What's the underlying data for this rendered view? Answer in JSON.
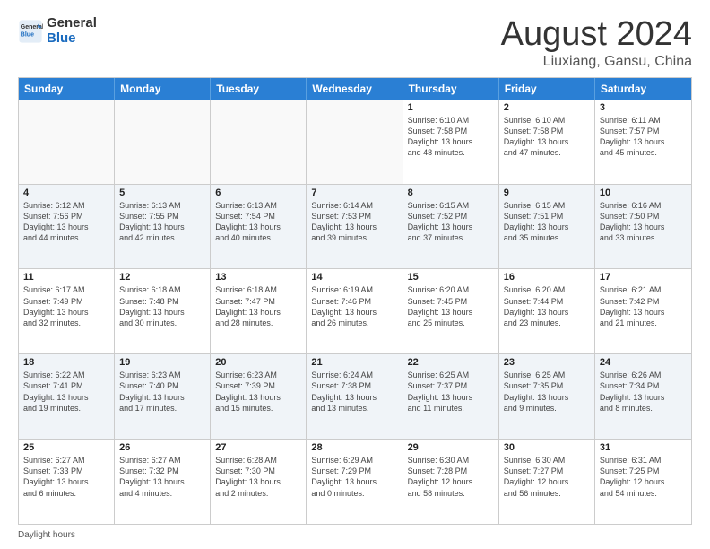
{
  "logo": {
    "text_general": "General",
    "text_blue": "Blue"
  },
  "title": "August 2024",
  "subtitle": "Liuxiang, Gansu, China",
  "days_of_week": [
    "Sunday",
    "Monday",
    "Tuesday",
    "Wednesday",
    "Thursday",
    "Friday",
    "Saturday"
  ],
  "footer_label": "Daylight hours",
  "weeks": [
    [
      {
        "day": "",
        "info": ""
      },
      {
        "day": "",
        "info": ""
      },
      {
        "day": "",
        "info": ""
      },
      {
        "day": "",
        "info": ""
      },
      {
        "day": "1",
        "info": "Sunrise: 6:10 AM\nSunset: 7:58 PM\nDaylight: 13 hours\nand 48 minutes."
      },
      {
        "day": "2",
        "info": "Sunrise: 6:10 AM\nSunset: 7:58 PM\nDaylight: 13 hours\nand 47 minutes."
      },
      {
        "day": "3",
        "info": "Sunrise: 6:11 AM\nSunset: 7:57 PM\nDaylight: 13 hours\nand 45 minutes."
      }
    ],
    [
      {
        "day": "4",
        "info": "Sunrise: 6:12 AM\nSunset: 7:56 PM\nDaylight: 13 hours\nand 44 minutes."
      },
      {
        "day": "5",
        "info": "Sunrise: 6:13 AM\nSunset: 7:55 PM\nDaylight: 13 hours\nand 42 minutes."
      },
      {
        "day": "6",
        "info": "Sunrise: 6:13 AM\nSunset: 7:54 PM\nDaylight: 13 hours\nand 40 minutes."
      },
      {
        "day": "7",
        "info": "Sunrise: 6:14 AM\nSunset: 7:53 PM\nDaylight: 13 hours\nand 39 minutes."
      },
      {
        "day": "8",
        "info": "Sunrise: 6:15 AM\nSunset: 7:52 PM\nDaylight: 13 hours\nand 37 minutes."
      },
      {
        "day": "9",
        "info": "Sunrise: 6:15 AM\nSunset: 7:51 PM\nDaylight: 13 hours\nand 35 minutes."
      },
      {
        "day": "10",
        "info": "Sunrise: 6:16 AM\nSunset: 7:50 PM\nDaylight: 13 hours\nand 33 minutes."
      }
    ],
    [
      {
        "day": "11",
        "info": "Sunrise: 6:17 AM\nSunset: 7:49 PM\nDaylight: 13 hours\nand 32 minutes."
      },
      {
        "day": "12",
        "info": "Sunrise: 6:18 AM\nSunset: 7:48 PM\nDaylight: 13 hours\nand 30 minutes."
      },
      {
        "day": "13",
        "info": "Sunrise: 6:18 AM\nSunset: 7:47 PM\nDaylight: 13 hours\nand 28 minutes."
      },
      {
        "day": "14",
        "info": "Sunrise: 6:19 AM\nSunset: 7:46 PM\nDaylight: 13 hours\nand 26 minutes."
      },
      {
        "day": "15",
        "info": "Sunrise: 6:20 AM\nSunset: 7:45 PM\nDaylight: 13 hours\nand 25 minutes."
      },
      {
        "day": "16",
        "info": "Sunrise: 6:20 AM\nSunset: 7:44 PM\nDaylight: 13 hours\nand 23 minutes."
      },
      {
        "day": "17",
        "info": "Sunrise: 6:21 AM\nSunset: 7:42 PM\nDaylight: 13 hours\nand 21 minutes."
      }
    ],
    [
      {
        "day": "18",
        "info": "Sunrise: 6:22 AM\nSunset: 7:41 PM\nDaylight: 13 hours\nand 19 minutes."
      },
      {
        "day": "19",
        "info": "Sunrise: 6:23 AM\nSunset: 7:40 PM\nDaylight: 13 hours\nand 17 minutes."
      },
      {
        "day": "20",
        "info": "Sunrise: 6:23 AM\nSunset: 7:39 PM\nDaylight: 13 hours\nand 15 minutes."
      },
      {
        "day": "21",
        "info": "Sunrise: 6:24 AM\nSunset: 7:38 PM\nDaylight: 13 hours\nand 13 minutes."
      },
      {
        "day": "22",
        "info": "Sunrise: 6:25 AM\nSunset: 7:37 PM\nDaylight: 13 hours\nand 11 minutes."
      },
      {
        "day": "23",
        "info": "Sunrise: 6:25 AM\nSunset: 7:35 PM\nDaylight: 13 hours\nand 9 minutes."
      },
      {
        "day": "24",
        "info": "Sunrise: 6:26 AM\nSunset: 7:34 PM\nDaylight: 13 hours\nand 8 minutes."
      }
    ],
    [
      {
        "day": "25",
        "info": "Sunrise: 6:27 AM\nSunset: 7:33 PM\nDaylight: 13 hours\nand 6 minutes."
      },
      {
        "day": "26",
        "info": "Sunrise: 6:27 AM\nSunset: 7:32 PM\nDaylight: 13 hours\nand 4 minutes."
      },
      {
        "day": "27",
        "info": "Sunrise: 6:28 AM\nSunset: 7:30 PM\nDaylight: 13 hours\nand 2 minutes."
      },
      {
        "day": "28",
        "info": "Sunrise: 6:29 AM\nSunset: 7:29 PM\nDaylight: 13 hours\nand 0 minutes."
      },
      {
        "day": "29",
        "info": "Sunrise: 6:30 AM\nSunset: 7:28 PM\nDaylight: 12 hours\nand 58 minutes."
      },
      {
        "day": "30",
        "info": "Sunrise: 6:30 AM\nSunset: 7:27 PM\nDaylight: 12 hours\nand 56 minutes."
      },
      {
        "day": "31",
        "info": "Sunrise: 6:31 AM\nSunset: 7:25 PM\nDaylight: 12 hours\nand 54 minutes."
      }
    ]
  ]
}
